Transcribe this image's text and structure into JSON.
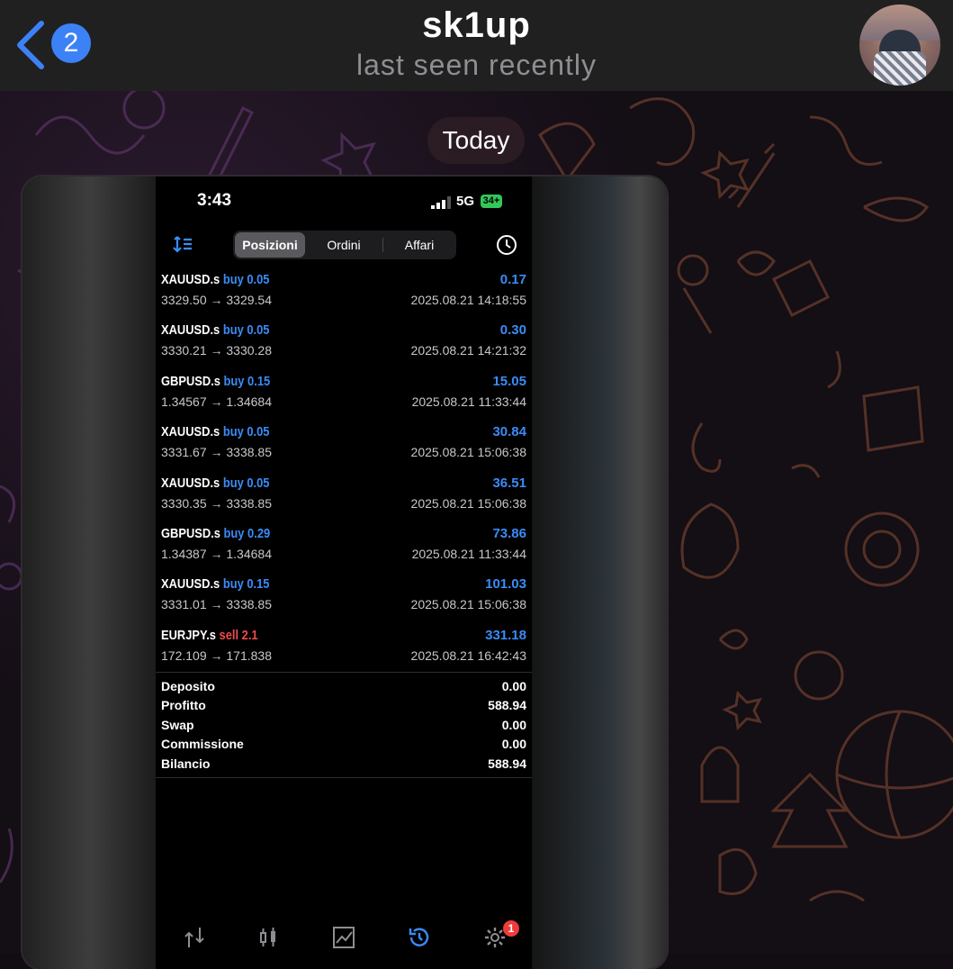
{
  "chat": {
    "title": "sk1up",
    "status": "last seen recently",
    "unread_count": "2",
    "date_separator": "Today"
  },
  "phone": {
    "time": "3:43",
    "network": "5G",
    "battery": "34+",
    "tabs": [
      {
        "label": "Posizioni",
        "active": true
      },
      {
        "label": "Ordini",
        "active": false
      },
      {
        "label": "Affari",
        "active": false
      }
    ],
    "trades": [
      {
        "symbol": "XAUUSD.s",
        "action": "buy 0.05",
        "side": "buy",
        "prices": "3329.50 → 3329.54",
        "profit": "0.17",
        "datetime": "2025.08.21 14:18:55"
      },
      {
        "symbol": "XAUUSD.s",
        "action": "buy 0.05",
        "side": "buy",
        "prices": "3330.21 → 3330.28",
        "profit": "0.30",
        "datetime": "2025.08.21 14:21:32"
      },
      {
        "symbol": "GBPUSD.s",
        "action": "buy 0.15",
        "side": "buy",
        "prices": "1.34567 → 1.34684",
        "profit": "15.05",
        "datetime": "2025.08.21 11:33:44"
      },
      {
        "symbol": "XAUUSD.s",
        "action": "buy 0.05",
        "side": "buy",
        "prices": "3331.67 → 3338.85",
        "profit": "30.84",
        "datetime": "2025.08.21 15:06:38"
      },
      {
        "symbol": "XAUUSD.s",
        "action": "buy 0.05",
        "side": "buy",
        "prices": "3330.35 → 3338.85",
        "profit": "36.51",
        "datetime": "2025.08.21 15:06:38"
      },
      {
        "symbol": "GBPUSD.s",
        "action": "buy 0.29",
        "side": "buy",
        "prices": "1.34387 → 1.34684",
        "profit": "73.86",
        "datetime": "2025.08.21 11:33:44"
      },
      {
        "symbol": "XAUUSD.s",
        "action": "buy 0.15",
        "side": "buy",
        "prices": "3331.01 → 3338.85",
        "profit": "101.03",
        "datetime": "2025.08.21 15:06:38"
      },
      {
        "symbol": "EURJPY.s",
        "action": "sell 2.1",
        "side": "sell",
        "prices": "172.109 → 171.838",
        "profit": "331.18",
        "datetime": "2025.08.21 16:42:43"
      }
    ],
    "summary": [
      {
        "label": "Deposito",
        "value": "0.00"
      },
      {
        "label": "Profitto",
        "value": "588.94"
      },
      {
        "label": "Swap",
        "value": "0.00"
      },
      {
        "label": "Commissione",
        "value": "0.00"
      },
      {
        "label": "Bilancio",
        "value": "588.94"
      }
    ],
    "settings_badge": "1"
  },
  "colors": {
    "accent_blue": "#3a8cf7",
    "sell_red": "#ef4b4b",
    "badge_blue": "#3c82f6"
  }
}
